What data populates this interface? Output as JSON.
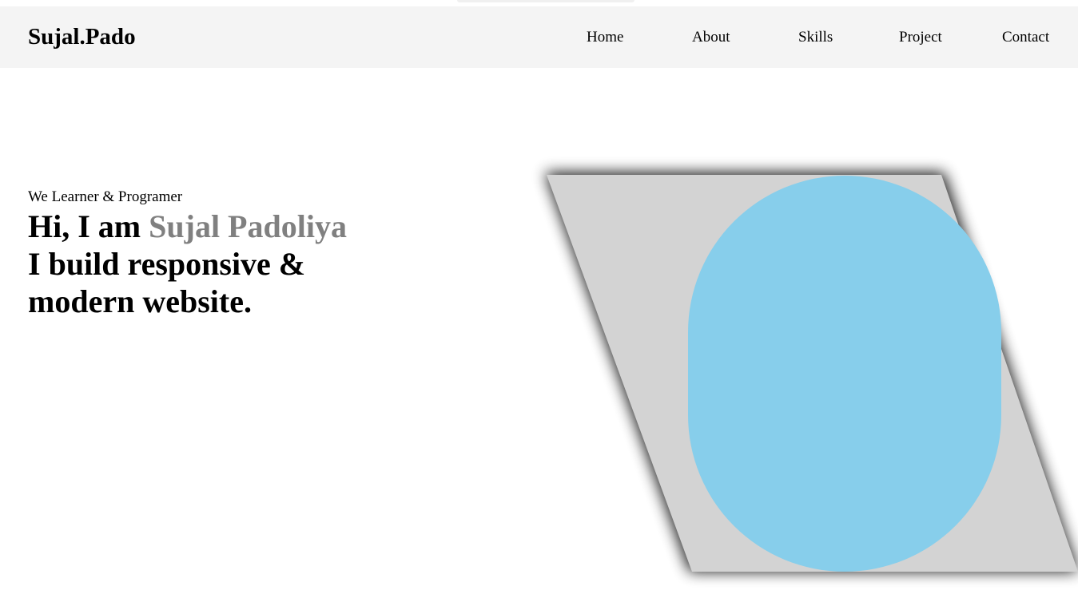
{
  "brand": {
    "logo": "Sujal.Pado"
  },
  "nav": {
    "items": [
      {
        "label": "Home"
      },
      {
        "label": "About"
      },
      {
        "label": "Skills"
      },
      {
        "label": "Project"
      },
      {
        "label": "Contact"
      }
    ]
  },
  "hero": {
    "tagline": "We Learner & Programer",
    "greeting": "Hi, I am ",
    "name": "Sujal Padoliya",
    "line2": "I build responsive &",
    "line3": "modern website."
  },
  "colors": {
    "navbar_bg": "#f4f4f4",
    "name_accent": "#808080",
    "parallelogram": "#d3d3d3",
    "shadow": "#000000",
    "blob": "#87ceeb"
  }
}
